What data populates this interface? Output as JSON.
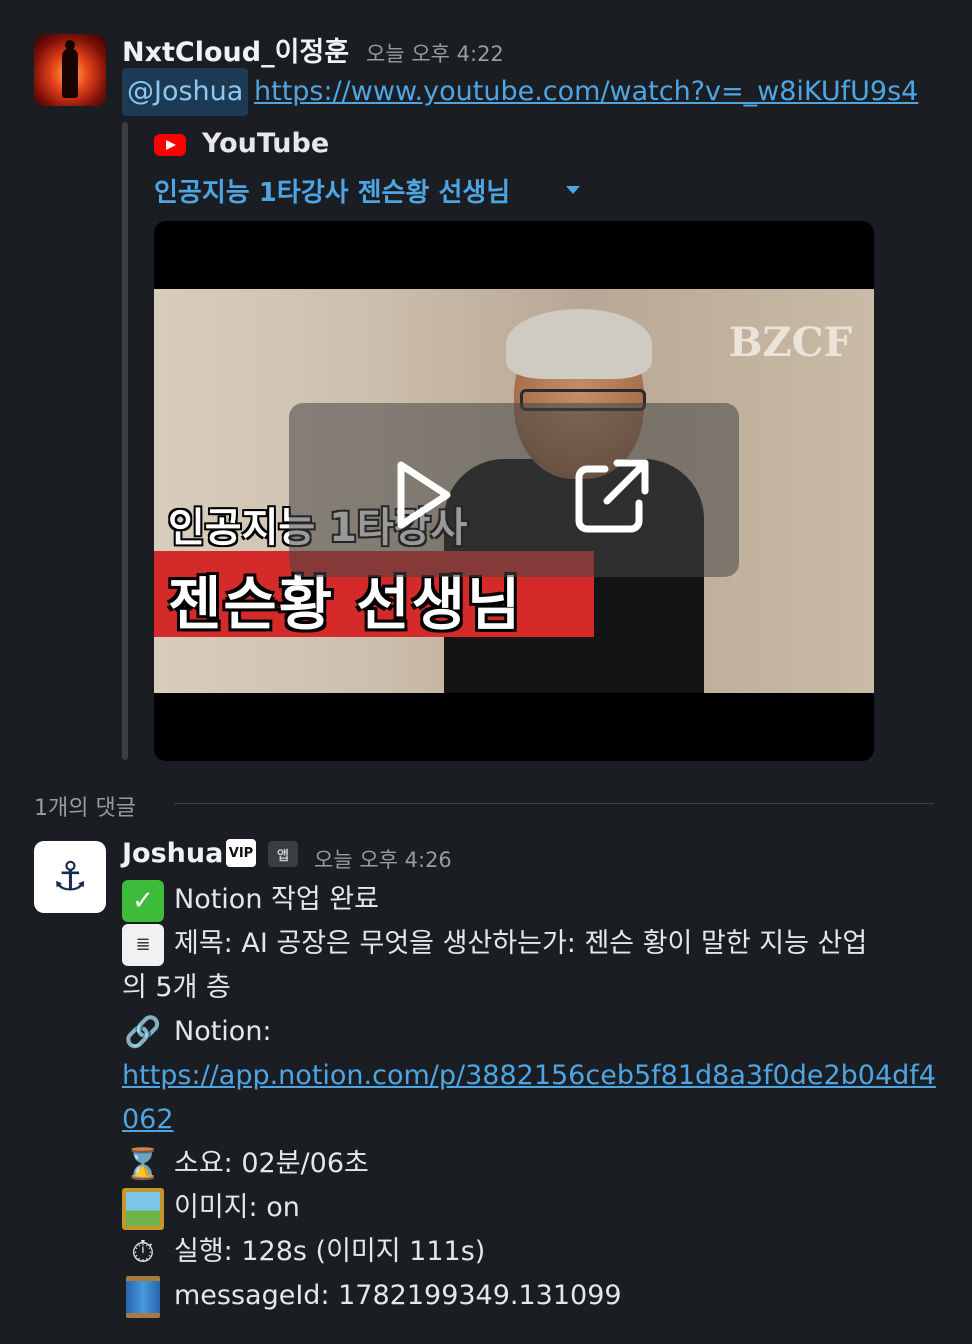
{
  "message1": {
    "author": "NxtCloud_이정훈",
    "time": "오늘 오후 4:22",
    "mention": "@Joshua",
    "link": "https://www.youtube.com/watch?v=_w8iKUfU9s4"
  },
  "attachment": {
    "provider": "YouTube",
    "title": "인공지능 1타강사 젠슨황 선생님",
    "thumbnail": {
      "watermark": "BZCF",
      "caption_top": "인공지능 1타강사",
      "caption_bottom": "젠슨황 선생님"
    }
  },
  "thread": {
    "label": "1개의 댓글"
  },
  "message2": {
    "author": "Joshua",
    "badge_vip": "VIP",
    "badge_app": "앱",
    "time": "오늘 오후 4:26",
    "lines": {
      "status": "Notion 작업 완료",
      "title_line1": "제목: AI 공장은 무엇을 생산하는가: 젠슨 황이 말한 지능 산업",
      "title_line2": "의 5개 층",
      "notion_label": "Notion:",
      "notion_link1": "https://app.notion.com/p/3882156ceb5f81d8a3f0de2b04df4",
      "notion_link2": "062",
      "duration": "소요: 02분/06초",
      "image": "이미지: on",
      "exec": "실행: 128s (이미지 111s)",
      "message_id": "messageId: 1782199349.131099"
    }
  },
  "icons": {
    "avatar1": "fire-figure-avatar",
    "avatar2": "anchor-icon",
    "play": "play-icon",
    "external": "external-link-icon",
    "status": "check-mark-icon",
    "title": "receipt-icon",
    "notion": "link-icon",
    "duration": "hourglass-icon",
    "image": "framed-picture-icon",
    "exec": "stopwatch-icon",
    "message_id": "thread-spool-icon"
  },
  "colors": {
    "background": "#1a1d21",
    "link": "#4ea5e3",
    "youtube_red": "#ff0000",
    "caption_red": "#d42a2a"
  }
}
